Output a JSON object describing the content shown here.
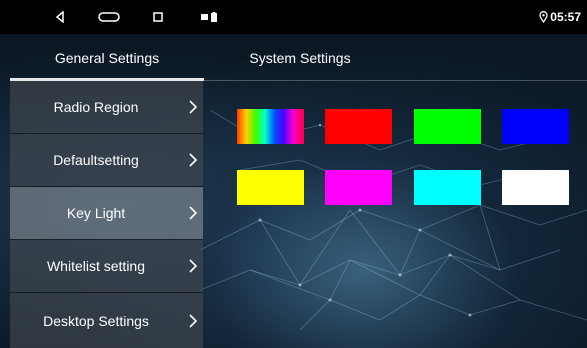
{
  "status_bar": {
    "time": "05:57",
    "icons": [
      "back-triangle-icon",
      "home-pill-icon",
      "recents-square-icon",
      "notification-dot-icon",
      "battery-icon",
      "location-pin-icon"
    ]
  },
  "tabs": [
    {
      "label": "General Settings",
      "active": true
    },
    {
      "label": "System Settings",
      "active": false
    }
  ],
  "sidebar": {
    "items": [
      {
        "label": "Radio Region"
      },
      {
        "label": "Defaultsetting"
      },
      {
        "label": "Key Light"
      },
      {
        "label": "Whitelist setting"
      },
      {
        "label": "Desktop Settings"
      }
    ],
    "selected": "Key Light"
  },
  "key_light_colors": [
    "rainbow-gradient",
    "#ff0000",
    "#00ff00",
    "#0000ff",
    "#ffff00",
    "#ff00ff",
    "#00ffff",
    "#ffffff"
  ]
}
